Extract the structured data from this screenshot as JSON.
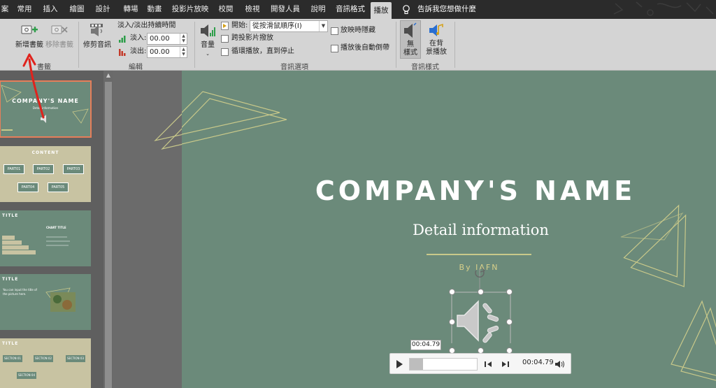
{
  "tabs": [
    {
      "label": "案",
      "ctx": false,
      "active": false
    },
    {
      "label": "常用",
      "ctx": false,
      "active": false
    },
    {
      "label": "插入",
      "ctx": false,
      "active": false
    },
    {
      "label": "繪圖",
      "ctx": false,
      "active": false
    },
    {
      "label": "設計",
      "ctx": false,
      "active": false
    },
    {
      "label": "轉場",
      "ctx": false,
      "active": false
    },
    {
      "label": "動畫",
      "ctx": false,
      "active": false
    },
    {
      "label": "投影片放映",
      "ctx": false,
      "active": false
    },
    {
      "label": "校閱",
      "ctx": false,
      "active": false
    },
    {
      "label": "檢視",
      "ctx": false,
      "active": false
    },
    {
      "label": "開發人員",
      "ctx": false,
      "active": false
    },
    {
      "label": "說明",
      "ctx": false,
      "active": false
    },
    {
      "label": "音訊格式",
      "ctx": true,
      "active": false
    },
    {
      "label": "播放",
      "ctx": true,
      "active": true
    }
  ],
  "tell_me": "告訴我您想做什麼",
  "ribbon": {
    "bookmarks": {
      "add_label": "新增書籤",
      "remove_label": "移除書籤",
      "group_label": "書籤"
    },
    "editing": {
      "trim_label": "修剪音訊",
      "fade_title": "淡入/淡出持續時間",
      "fade_in_label": "淡入:",
      "fade_in_value": "00.00",
      "fade_out_label": "淡出:",
      "fade_out_value": "00.00",
      "group_label": "編輯"
    },
    "audio_options": {
      "volume_label": "音量",
      "start_label": "開始:",
      "start_value": "從按滑鼠順序(I)",
      "play_across_slides": "跨投影片撥放",
      "loop_until_stopped": "循環播放，直到停止",
      "hide_during_show": "放映時隱藏",
      "rewind_after_playing": "播放後自動倒帶",
      "group_label": "音訊選項"
    },
    "audio_styles": {
      "no_style_line1": "無",
      "no_style_line2": "樣式",
      "bg_line1": "在背",
      "bg_line2": "景播放",
      "group_label": "音訊樣式"
    }
  },
  "thumbnails": [
    {
      "title": "COMPANY'S NAME",
      "subtitle": "Detail information"
    },
    {
      "title": "CONTENT",
      "items": [
        "PART01",
        "PART02",
        "PART03",
        "PART04",
        "PART05"
      ]
    },
    {
      "title": "TITLE",
      "chart_title": "CHART TITLE"
    },
    {
      "title": "TITLE",
      "body": "You can input the title of the picture here."
    },
    {
      "title": "TITLE",
      "sections": [
        "SECTION 01",
        "SECTION 02",
        "SECTION 03",
        "SECTION 04"
      ]
    }
  ],
  "slide": {
    "title": "COMPANY'S NAME",
    "subtitle": "Detail information",
    "byline": "By IAFN",
    "colors": {
      "background": "#6b8a7a",
      "accent": "#c9c98a"
    }
  },
  "player": {
    "tooltip_time": "00:04.79",
    "duration": "00:04.79",
    "progress": 0.2
  },
  "colors": {
    "tabbar": "#2b2b2b",
    "ribbon": "#d4d4d4",
    "annotation_arrow": "#e0221c",
    "selected_outline": "#e67e5a"
  }
}
